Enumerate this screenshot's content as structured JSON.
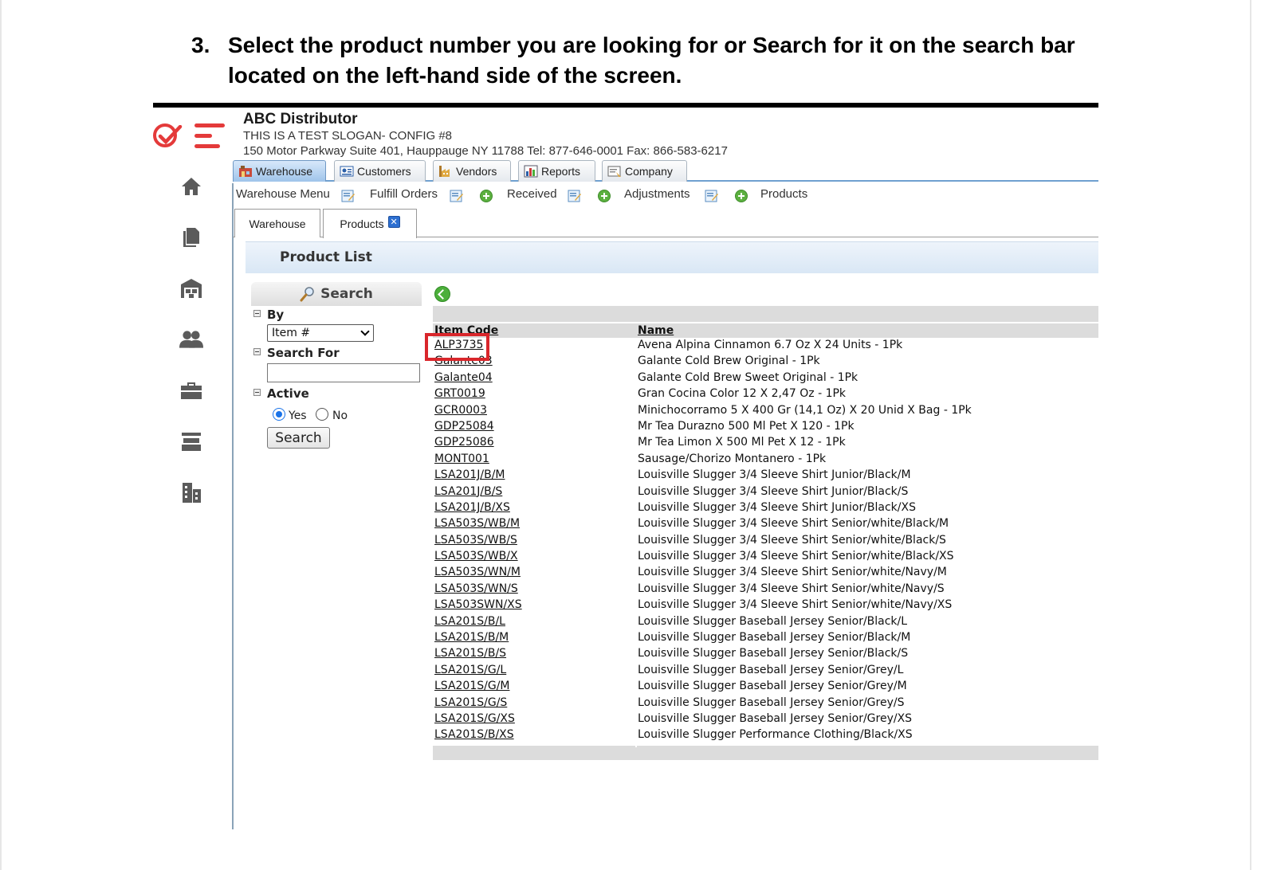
{
  "instruction": {
    "number": "3.",
    "text": "Select the product number you are looking for or Search for it on the search bar located on the left-hand side of the screen."
  },
  "header": {
    "company": "ABC Distributor",
    "slogan": "THIS IS A TEST SLOGAN- CONFIG #8",
    "address": "150 Motor Parkway Suite 401, Hauppauge NY 11788 Tel: 877-646-0001 Fax: 866-583-6217"
  },
  "rail": {
    "icons": [
      "home-icon",
      "documents-icon",
      "warehouse-icon",
      "users-icon",
      "briefcase-icon",
      "stack-icon",
      "buildings-icon"
    ]
  },
  "topnav": {
    "tabs": [
      {
        "label": "Warehouse",
        "icon": "warehouse-icon",
        "active": true
      },
      {
        "label": "Customers",
        "icon": "address-card-icon",
        "active": false
      },
      {
        "label": "Vendors",
        "icon": "factory-icon",
        "active": false
      },
      {
        "label": "Reports",
        "icon": "chart-icon",
        "active": false
      },
      {
        "label": "Company",
        "icon": "certificate-icon",
        "active": false
      }
    ]
  },
  "submenu": {
    "items": [
      "Warehouse Menu",
      "Fulfill Orders",
      "Received",
      "Adjustments",
      "Products"
    ]
  },
  "pagetabs": [
    {
      "label": "Warehouse",
      "active": false
    },
    {
      "label": "Products",
      "active": true,
      "closable": true
    }
  ],
  "product_list": {
    "title": "Product List"
  },
  "search": {
    "header": "Search",
    "by_label": "By",
    "by_value": "Item #",
    "search_for_label": "Search For",
    "search_for_value": "",
    "active_label": "Active",
    "yes_label": "Yes",
    "no_label": "No",
    "active_selected": "Yes",
    "button_label": "Search"
  },
  "table": {
    "columns": [
      "Item Code",
      "Name"
    ],
    "highlighted_row": 0,
    "rows": [
      {
        "code": "ALP3735",
        "name": "Avena Alpina Cinnamon 6.7 Oz X 24 Units - 1Pk"
      },
      {
        "code": "Galante03",
        "name": "Galante Cold Brew Original - 1Pk"
      },
      {
        "code": "Galante04",
        "name": "Galante Cold Brew Sweet Original - 1Pk"
      },
      {
        "code": "GRT0019",
        "name": "Gran Cocina Color 12 X 2,47 Oz - 1Pk"
      },
      {
        "code": "GCR0003",
        "name": "Minichocorramo 5 X 400 Gr (14,1 Oz) X 20 Unid X Bag - 1Pk"
      },
      {
        "code": "GDP25084",
        "name": "Mr Tea Durazno 500 Ml Pet X 120 - 1Pk"
      },
      {
        "code": "GDP25086",
        "name": "Mr Tea Limon X 500 Ml Pet X 12 - 1Pk"
      },
      {
        "code": "MONT001",
        "name": "Sausage/Chorizo Montanero - 1Pk"
      },
      {
        "code": "LSA201J/B/M",
        "name": "Louisville Slugger 3/4 Sleeve Shirt Junior/Black/M"
      },
      {
        "code": "LSA201J/B/S",
        "name": "Louisville Slugger 3/4 Sleeve Shirt Junior/Black/S"
      },
      {
        "code": "LSA201J/B/XS",
        "name": "Louisville Slugger 3/4 Sleeve Shirt Junior/Black/XS"
      },
      {
        "code": "LSA503S/WB/M",
        "name": "Louisville Slugger 3/4 Sleeve Shirt Senior/white/Black/M"
      },
      {
        "code": "LSA503S/WB/S",
        "name": "Louisville Slugger 3/4 Sleeve Shirt Senior/white/Black/S"
      },
      {
        "code": "LSA503S/WB/X",
        "name": "Louisville Slugger 3/4 Sleeve Shirt Senior/white/Black/XS"
      },
      {
        "code": "LSA503S/WN/M",
        "name": "Louisville Slugger 3/4 Sleeve Shirt Senior/white/Navy/M"
      },
      {
        "code": "LSA503S/WN/S",
        "name": "Louisville Slugger 3/4 Sleeve Shirt Senior/white/Navy/S"
      },
      {
        "code": "LSA503SWN/XS",
        "name": "Louisville Slugger 3/4 Sleeve Shirt Senior/white/Navy/XS"
      },
      {
        "code": "LSA201S/B/L",
        "name": "Louisville Slugger Baseball Jersey Senior/Black/L"
      },
      {
        "code": "LSA201S/B/M",
        "name": "Louisville Slugger Baseball Jersey Senior/Black/M"
      },
      {
        "code": "LSA201S/B/S",
        "name": "Louisville Slugger Baseball Jersey Senior/Black/S"
      },
      {
        "code": "LSA201S/G/L",
        "name": "Louisville Slugger Baseball Jersey Senior/Grey/L"
      },
      {
        "code": "LSA201S/G/M",
        "name": "Louisville Slugger Baseball Jersey Senior/Grey/M"
      },
      {
        "code": "LSA201S/G/S",
        "name": "Louisville Slugger Baseball Jersey Senior/Grey/S"
      },
      {
        "code": "LSA201S/G/XS",
        "name": "Louisville Slugger Baseball Jersey Senior/Grey/XS"
      },
      {
        "code": "LSA201S/B/XS",
        "name": "Louisville Slugger Performance Clothing/Black/XS"
      }
    ]
  },
  "colors": {
    "brand_red": "#e43a3a",
    "highlight_red": "#d9262b",
    "tab_active_blue": "#9fc4ea",
    "banner_blue": "#d9e7f5",
    "grid_gray": "#dcdcdc"
  }
}
